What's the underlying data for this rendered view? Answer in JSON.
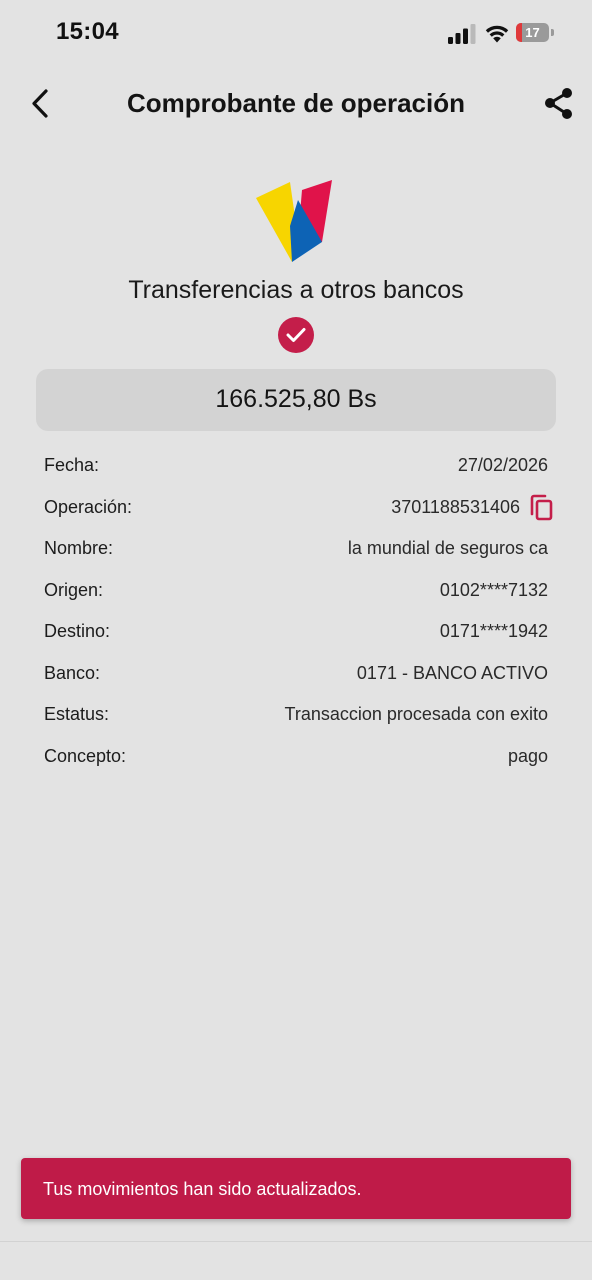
{
  "status_bar": {
    "time": "15:04",
    "battery_level": "17",
    "battery_fraction": 0.17
  },
  "header": {
    "title": "Comprobante de operación",
    "back_icon": "chevron-left-icon",
    "share_icon": "share-icon"
  },
  "receipt": {
    "transfer_type": "Transferencias a otros bancos",
    "amount": "166.525,80 Bs",
    "details": [
      {
        "label": "Fecha:",
        "value": "27/02/2026"
      },
      {
        "label": "Operación:",
        "value": "3701188531406"
      },
      {
        "label": "Nombre:",
        "value": "la mundial de seguros ca"
      },
      {
        "label": "Origen:",
        "value": "0102****7132"
      },
      {
        "label": "Destino:",
        "value": "0171****1942"
      },
      {
        "label": "Banco:",
        "value": "0171 - BANCO ACTIVO"
      },
      {
        "label": "Estatus:",
        "value": "Transaccion procesada con exito"
      },
      {
        "label": "Concepto:",
        "value": "pago"
      }
    ]
  },
  "snackbar": {
    "message": "Tus movimientos han sido actualizados."
  },
  "colors": {
    "background": "#e3e3e3",
    "accent": "#c41e4a",
    "amount_box": "#d3d3d3",
    "logo_yellow": "#f7d500",
    "logo_blue": "#0d63b5",
    "logo_red": "#e0134a"
  }
}
